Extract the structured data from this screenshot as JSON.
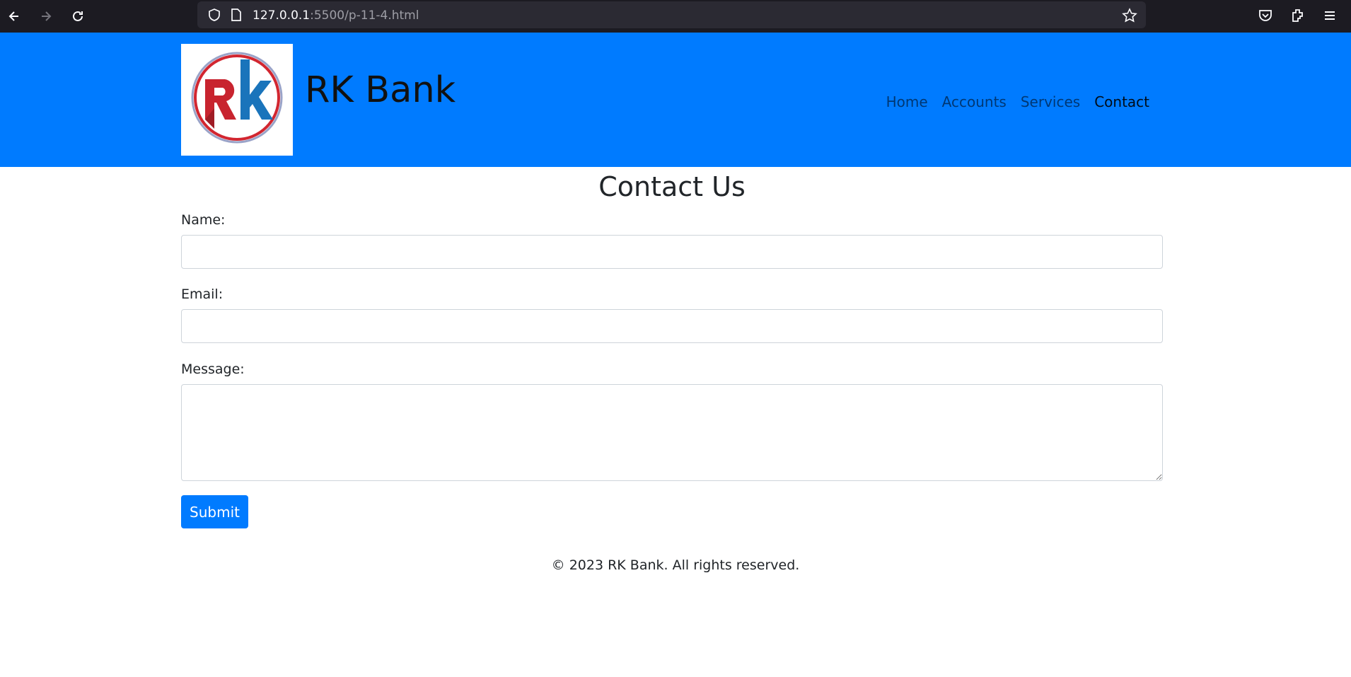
{
  "browser": {
    "url_host": "127.0.0.1",
    "url_path": ":5500/p-11-4.html"
  },
  "header": {
    "brand_title": "RK Bank",
    "logo_letters": "Rk",
    "nav": [
      {
        "label": "Home"
      },
      {
        "label": "Accounts"
      },
      {
        "label": "Services"
      },
      {
        "label": "Contact"
      }
    ]
  },
  "main": {
    "title": "Contact Us",
    "form": {
      "name_label": "Name:",
      "name_value": "",
      "email_label": "Email:",
      "email_value": "",
      "message_label": "Message:",
      "message_value": "",
      "submit_label": "Submit"
    }
  },
  "footer": {
    "text": "© 2023 RK Bank. All rights reserved."
  },
  "colors": {
    "header_bg": "#007bff",
    "button_bg": "#007bff",
    "browser_bg": "#1c1b22"
  }
}
